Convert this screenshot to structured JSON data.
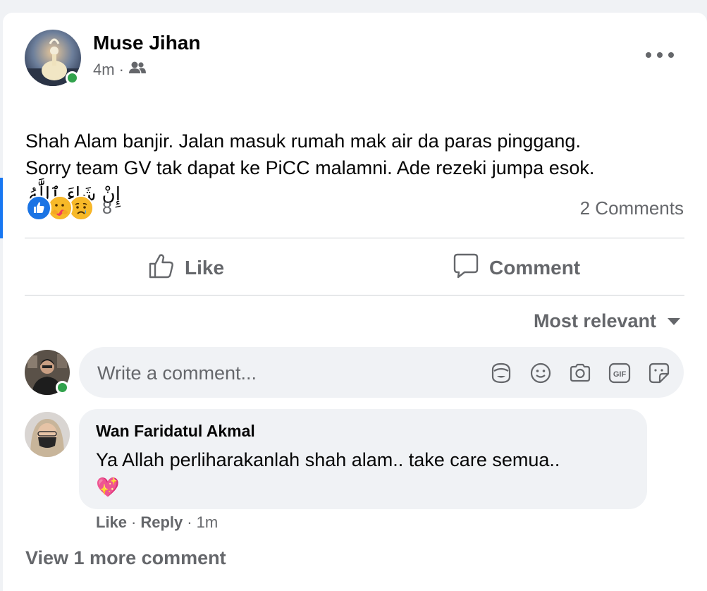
{
  "post": {
    "author": "Muse Jihan",
    "time": "4m",
    "separator": "·",
    "audience_icon": "friends-icon",
    "text": "Shah Alam banjir. Jalan masuk rumah mak air da paras pinggang.\nSorry team GV tak dapat ke PiCC malamni. Ade rezeki jumpa esok.",
    "arabic_text": "إِنْ شَاءَ ٱللَّٰهُ",
    "reaction_count": "8",
    "reactions": [
      "like",
      "care",
      "sad"
    ],
    "comments_count": "2 Comments",
    "accent_color": "#1877f2"
  },
  "actions": {
    "like_label": "Like",
    "comment_label": "Comment"
  },
  "sort": {
    "label": "Most relevant"
  },
  "composer": {
    "placeholder": "Write a comment...",
    "tools": [
      "avatar-sticker-icon",
      "emoji-icon",
      "camera-icon",
      "gif-icon",
      "sticker-icon"
    ]
  },
  "comment": {
    "author": "Wan Faridatul Akmal",
    "text": "Ya Allah perliharakanlah shah alam.. take care semua..",
    "emoji": "💖",
    "like_label": "Like",
    "reply_label": "Reply",
    "time": "1m",
    "dot": "·"
  },
  "view_more": "View 1 more comment"
}
